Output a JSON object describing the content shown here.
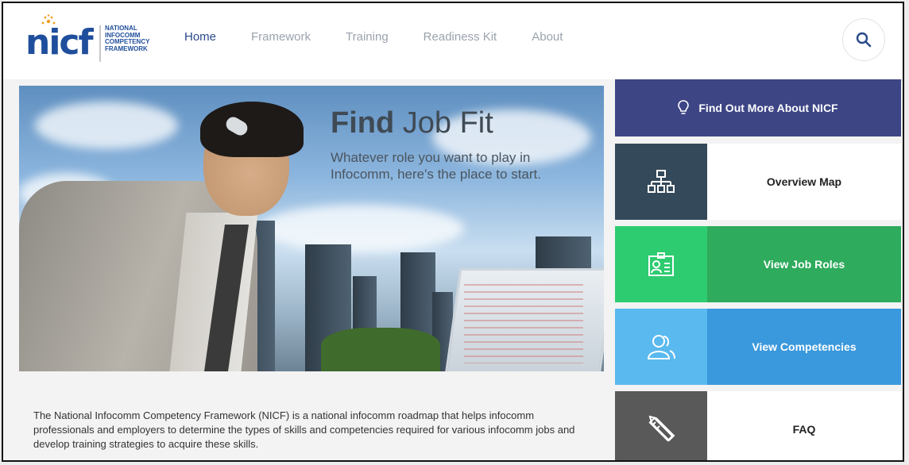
{
  "logo": {
    "mark": "nicf",
    "lines": [
      "NATIONAL",
      "INFOCOMM",
      "COMPETENCY",
      "FRAMEWORK"
    ]
  },
  "nav": {
    "items": [
      "Home",
      "Framework",
      "Training",
      "Readiness Kit",
      "About"
    ],
    "active": "Home"
  },
  "search": {
    "icon": "search-icon"
  },
  "hero": {
    "title_bold": "Find",
    "title_rest": "Job Fit",
    "subtitle": "Whatever role you want to play in Infocomm, here's the place to start."
  },
  "description": "The National Infocomm Competency Framework (NICF) is a national infocomm roadmap that helps infocomm professionals and employers to determine the types of skills and competencies required for various infocomm jobs and develop training strategies to acquire these skills.",
  "sidebar": {
    "find_more": {
      "label": "Find Out More About NICF",
      "icon": "lightbulb-icon",
      "color": "#3d4585"
    },
    "tiles": [
      {
        "label": "Overview Map",
        "icon": "sitemap-icon",
        "icon_bg": "#34495a",
        "label_bg": "#ffffff"
      },
      {
        "label": "View Job Roles",
        "icon": "id-card-icon",
        "icon_bg": "#2ecc71",
        "label_bg": "#2eab5c"
      },
      {
        "label": "View Competencies",
        "icon": "users-icon",
        "icon_bg": "#5ab9ef",
        "label_bg": "#3a98dc"
      },
      {
        "label": "FAQ",
        "icon": "pencil-ruler-icon",
        "icon_bg": "#595959",
        "label_bg": "#ffffff"
      }
    ]
  },
  "colors": {
    "brand": "#1f4e9c",
    "nav_active": "#2a4a8a",
    "nav_inactive": "#9aa3ad"
  }
}
